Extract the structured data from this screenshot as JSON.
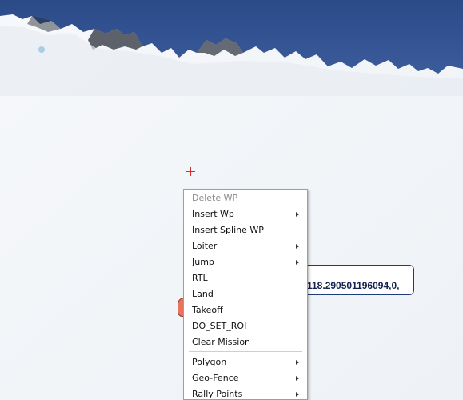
{
  "map": {
    "colors": {
      "ocean": "#2f4f8f",
      "ice": "#f3f5f8",
      "coast": "#e6ebf1"
    }
  },
  "tooltip": {
    "text": "118.290501196094,0,"
  },
  "context_menu": {
    "items": [
      {
        "label": "Delete WP",
        "submenu": false,
        "disabled": true
      },
      {
        "label": "Insert Wp",
        "submenu": true,
        "disabled": false
      },
      {
        "label": "Insert Spline WP",
        "submenu": false,
        "disabled": false
      },
      {
        "label": "Loiter",
        "submenu": true,
        "disabled": false
      },
      {
        "label": "Jump",
        "submenu": true,
        "disabled": false
      },
      {
        "label": "RTL",
        "submenu": false,
        "disabled": false
      },
      {
        "label": "Land",
        "submenu": false,
        "disabled": false
      },
      {
        "label": "Takeoff",
        "submenu": false,
        "disabled": false
      },
      {
        "label": "DO_SET_ROI",
        "submenu": false,
        "disabled": false
      },
      {
        "label": "Clear Mission",
        "submenu": false,
        "disabled": false
      },
      {
        "label": "Polygon",
        "submenu": true,
        "disabled": false
      },
      {
        "label": "Geo-Fence",
        "submenu": true,
        "disabled": false
      },
      {
        "label": "Rally Points",
        "submenu": true,
        "disabled": false
      }
    ]
  }
}
